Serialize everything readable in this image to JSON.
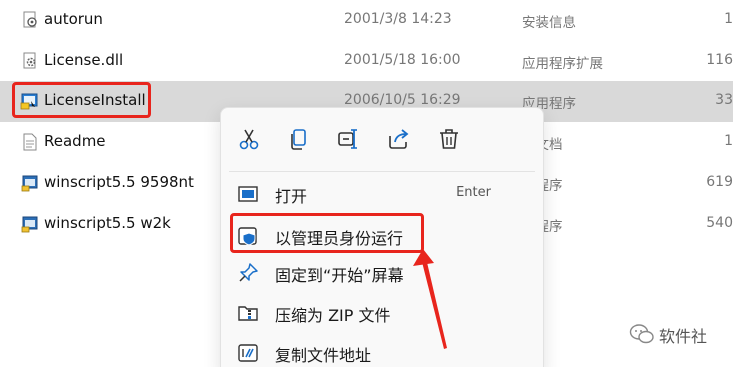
{
  "files": [
    {
      "name": "autorun",
      "date": "2001/3/8 14:23",
      "type": "安装信息",
      "size": "1",
      "icon": "setup-info-icon"
    },
    {
      "name": "License.dll",
      "date": "2001/5/18 16:00",
      "type": "应用程序扩展",
      "size": "116",
      "icon": "dll-file-icon"
    },
    {
      "name": "LicenseInstall",
      "date": "2006/10/5 16:29",
      "type": "应用程序",
      "size": "33",
      "icon": "installer-app-icon",
      "selected": true
    },
    {
      "name": "Readme",
      "date": "",
      "type": "本文档",
      "size": "1",
      "icon": "text-document-icon"
    },
    {
      "name": "winscript5.5 9598nt",
      "date": "",
      "type": "用程序",
      "size": "619",
      "icon": "application-icon"
    },
    {
      "name": "winscript5.5 w2k",
      "date": "",
      "type": "用程序",
      "size": "540",
      "icon": "application-icon"
    }
  ],
  "context_menu": {
    "quick_actions": [
      "cut-icon",
      "copy-icon",
      "rename-icon",
      "share-icon",
      "delete-icon"
    ],
    "items": [
      {
        "label": "打开",
        "shortcut": "Enter",
        "icon": "open-app-icon"
      },
      {
        "label": "以管理员身份运行",
        "shortcut": "",
        "icon": "admin-shield-icon"
      },
      {
        "label": "固定到“开始”屏幕",
        "shortcut": "",
        "icon": "pin-icon"
      },
      {
        "label": "压缩为 ZIP 文件",
        "shortcut": "",
        "icon": "zip-folder-icon"
      },
      {
        "label": "复制文件地址",
        "shortcut": "",
        "icon": "copy-path-icon"
      }
    ]
  },
  "watermark": {
    "label": "软件社",
    "icon": "wechat-icon"
  },
  "colors": {
    "highlight": "#e8251d",
    "accent": "#1a6fc9",
    "selected_row": "#d9d9d9"
  }
}
